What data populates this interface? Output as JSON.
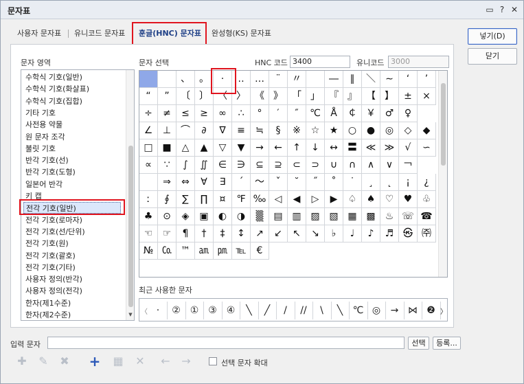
{
  "window": {
    "title": "문자표",
    "help_icon": "?",
    "close_icon": "✕",
    "msg_icon": "▭"
  },
  "tabs": [
    {
      "label": "사용자 문자표"
    },
    {
      "label": "유니코드 문자표"
    },
    {
      "label": "훈글(HNC) 문자표"
    },
    {
      "label": "완성형(KS) 문자표"
    }
  ],
  "area": {
    "label": "문자 영역",
    "items": [
      "수학식 기호(일반)",
      "수학식 기호(화살표)",
      "수학식 기호(집합)",
      "기타 기호",
      "사전용 약물",
      "원 문자 조각",
      "불릿 기호",
      "반각 기호(선)",
      "반각 기호(도형)",
      "일본어 반각",
      "키 캡",
      "전각 기호(일반)",
      "전각 기호(로마자)",
      "전각 기호(선/단위)",
      "전각 기호(원)",
      "전각 기호(괄호)",
      "전각 기호(기타)",
      "사용자 정의(반각)",
      "사용자 정의(전각)",
      "한자(제1수준)",
      "한자(제2수준)"
    ],
    "selected_index": 11
  },
  "select": {
    "label": "문자 선택",
    "hnc_label": "HNC 코드",
    "hnc_value": "3400",
    "uni_label": "유니코드",
    "uni_value": "3000",
    "rows": [
      [
        "",
        " ",
        "、",
        "。",
        "·",
        "‥",
        "…",
        "¨",
        "〃",
        "­",
        "―",
        "∥",
        "＼",
        "∼",
        "‘",
        "’"
      ],
      [
        "“",
        "”",
        "〔",
        "〕",
        "〈",
        "〉",
        "《",
        "》",
        "「",
        "」",
        "『",
        "』",
        "【",
        "】",
        "±",
        "×"
      ],
      [
        "÷",
        "≠",
        "≤",
        "≥",
        "∞",
        "∴",
        "°",
        "′",
        "″",
        "℃",
        "Å",
        "￠",
        "￥",
        "♂",
        "♀"
      ],
      [
        "∠",
        "⊥",
        "⌒",
        "∂",
        "∇",
        "≡",
        "≒",
        "§",
        "※",
        "☆",
        "★",
        "○",
        "●",
        "◎",
        "◇",
        "◆"
      ],
      [
        "□",
        "■",
        "△",
        "▲",
        "▽",
        "▼",
        "→",
        "←",
        "↑",
        "↓",
        "↔",
        "〓",
        "≪",
        "≫",
        "√",
        "∽"
      ],
      [
        "∝",
        "∵",
        "∫",
        "∬",
        "∈",
        "∋",
        "⊆",
        "⊇",
        "⊂",
        "⊃",
        "∪",
        "∩",
        "∧",
        "∨",
        "￢"
      ],
      [
        " ",
        "⇒",
        "⇔",
        "∀",
        "∃",
        "´",
        "～",
        "ˇ",
        "˘",
        "˝",
        "˚",
        "˙",
        "¸",
        "˛",
        "¡",
        "¿"
      ],
      [
        "ː",
        "∮",
        "∑",
        "∏",
        "¤",
        "℉",
        "‰",
        "◁",
        "◀",
        "▷",
        "▶",
        "♤",
        "♠",
        "♡",
        "♥",
        "♧"
      ],
      [
        "♣",
        "⊙",
        "◈",
        "▣",
        "◐",
        "◑",
        "▒",
        "▤",
        "▥",
        "▨",
        "▧",
        "▦",
        "▩",
        "♨",
        "☏",
        "☎"
      ],
      [
        "☜",
        "☞",
        "¶",
        "†",
        "‡",
        "↕",
        "↗",
        "↙",
        "↖",
        "↘",
        "♭",
        "♩",
        "♪",
        "♬",
        "㉿",
        "㈜"
      ],
      [
        "№",
        "㏇",
        "™",
        "㏂",
        "㏘",
        "℡",
        "€"
      ]
    ]
  },
  "recent": {
    "label": "최근 사용한 문자",
    "chars": [
      "·",
      "②",
      "①",
      "③",
      "④",
      "╲",
      "╱",
      "/",
      "//",
      "\\",
      "╲",
      "℃",
      "◎",
      "→",
      "⋈",
      "❷"
    ]
  },
  "input": {
    "label": "입력 문자",
    "value": "",
    "select_btn": "선택",
    "register_btn": "등록..."
  },
  "buttons": {
    "insert": "넣기(D)",
    "close": "닫기"
  },
  "toolbar": {
    "enlarge_label": "선택 문자 확대"
  }
}
